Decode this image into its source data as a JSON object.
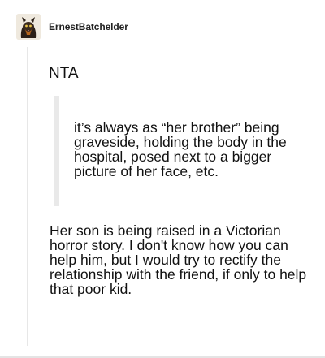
{
  "post": {
    "author": "ErnestBatchelder",
    "reply": "NTA",
    "quote": "it’s always as “her brother” being graveside, holding the body in the hospital, posed next to a bigger picture of her face, etc.",
    "body": "Her son is being raised in a Victorian horror story. I don't know how you can help him, but I would try to rectify the relationship with the friend, if only to help that poor kid."
  },
  "colors": {
    "text": "#111111",
    "quote_bar": "#e9e9e9",
    "thread_line": "#e7e7e7"
  }
}
